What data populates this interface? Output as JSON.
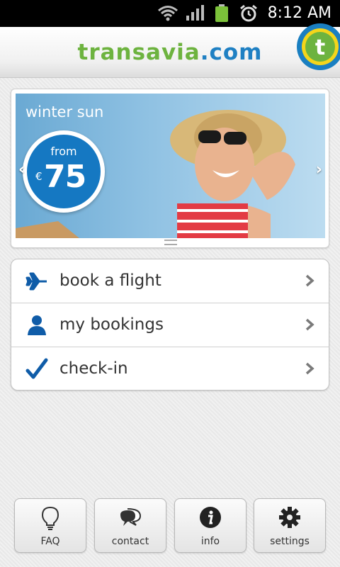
{
  "status_bar": {
    "time": "8:12 AM"
  },
  "header": {
    "logo_part1": "transavia",
    "logo_part2": ".com",
    "badge_letter": "t"
  },
  "banner": {
    "headline": "winter sun",
    "price_from": "from",
    "currency": "€",
    "price": "75"
  },
  "menu": {
    "items": [
      {
        "label": "book a flight",
        "icon": "plane-icon"
      },
      {
        "label": "my bookings",
        "icon": "person-icon"
      },
      {
        "label": "check-in",
        "icon": "checkmark-icon"
      }
    ]
  },
  "bottom_bar": {
    "buttons": [
      {
        "label": "FAQ",
        "icon": "lightbulb-icon"
      },
      {
        "label": "contact",
        "icon": "chat-bubbles-icon"
      },
      {
        "label": "info",
        "icon": "info-icon"
      },
      {
        "label": "settings",
        "icon": "gear-icon"
      }
    ]
  },
  "colors": {
    "brand_green": "#6db33f",
    "brand_blue": "#1f80c3",
    "price_blue": "#1578c2"
  }
}
